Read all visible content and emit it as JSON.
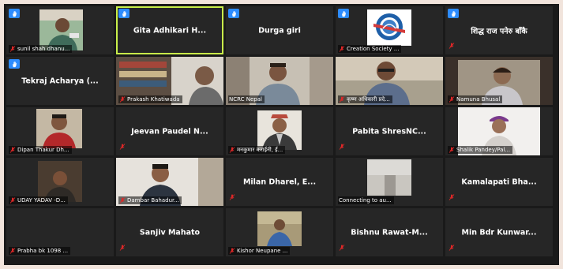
{
  "colors": {
    "background": "#262626",
    "active_speaker": "#c9f04a",
    "muted_mic": "#e02828",
    "hand_badge": "#2d8cff"
  },
  "participants": [
    {
      "center_name": "",
      "label": "sunil shah dhanu...",
      "hand": true,
      "photo": "person-green-background"
    },
    {
      "center_name": "Gita Adhikari H...",
      "label": "",
      "hand": true,
      "active": true
    },
    {
      "center_name": "Durga giri",
      "label": "",
      "hand": true
    },
    {
      "center_name": "",
      "label": "Creation Society ...",
      "hand": true,
      "photo": "organization-logo"
    },
    {
      "center_name": "शिद्ध राज पनेरु बाँकै",
      "label": "",
      "hand": true
    },
    {
      "center_name": "Tekraj Acharya (...",
      "label": "",
      "hand": true
    },
    {
      "center_name": "",
      "label": "Prakash Khatiwada",
      "hand": false,
      "photo": "man-with-bookshelf"
    },
    {
      "center_name": "",
      "label": "NCRC Nepal",
      "hand": false,
      "photo": "man-in-office"
    },
    {
      "center_name": "",
      "label": "कृष्ण अधिकारी प्रदे...",
      "hand": false,
      "photo": "man-with-glasses"
    },
    {
      "center_name": "",
      "label": "Namuna Bhusal",
      "hand": false,
      "photo": "woman-with-glasses"
    },
    {
      "center_name": "",
      "label": "Dipan Thakur Dh...",
      "hand": false,
      "photo": "man-red-shirt"
    },
    {
      "center_name": "Jeevan Paudel N...",
      "label": "",
      "hand": false
    },
    {
      "center_name": "",
      "label": "मनकुमार कराईनी, ई...",
      "hand": false,
      "photo": "man-with-topi"
    },
    {
      "center_name": "Pabita ShresNC...",
      "label": "",
      "hand": false
    },
    {
      "center_name": "",
      "label": "Shalik Pandey/Pal...",
      "hand": false,
      "photo": "man-with-cap"
    },
    {
      "center_name": "",
      "label": "UDAY YADAV -D...",
      "hand": false,
      "photo": "man-dim-room"
    },
    {
      "center_name": "",
      "label": "Dambar Bahadur...",
      "hand": false,
      "photo": "young-man-white-wall"
    },
    {
      "center_name": "Milan Dharel, E...",
      "label": "",
      "hand": false
    },
    {
      "center_name": "",
      "label": "Connecting to au...",
      "hand": false,
      "connecting": true,
      "photo": "gray-room"
    },
    {
      "center_name": "Kamalapati Bha...",
      "label": "",
      "hand": false
    },
    {
      "center_name": "",
      "label": "Prabha bk 1098 ...",
      "hand": false
    },
    {
      "center_name": "Sanjiv Mahato",
      "label": "",
      "hand": false,
      "mic_only": true
    },
    {
      "center_name": "",
      "label": "Kishor Neupane ...",
      "hand": false,
      "photo": "man-outdoors"
    },
    {
      "center_name": "Bishnu Rawat-M...",
      "label": "",
      "hand": false,
      "mic_only": true
    },
    {
      "center_name": "Min Bdr Kunwar...",
      "label": "",
      "hand": false,
      "mic_only": true
    }
  ]
}
